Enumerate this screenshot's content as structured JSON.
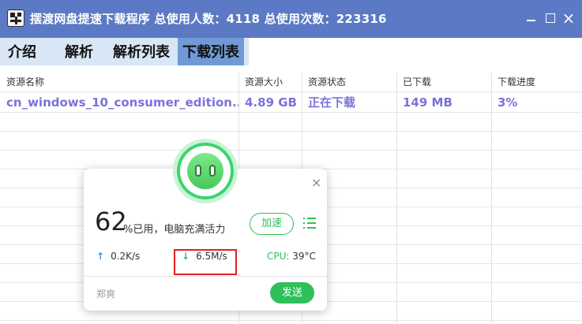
{
  "window": {
    "title": "摆渡网盘提速下载程序 总使用人数：4118 总使用次数：223316",
    "icon": "app-icon",
    "controls": {
      "minimize": "minimize-icon",
      "maximize": "maximize-icon",
      "close": "×"
    }
  },
  "tabs": [
    {
      "label": "介绍"
    },
    {
      "label": "解析"
    },
    {
      "label": "解析列表"
    },
    {
      "label": "下载列表",
      "active": true
    }
  ],
  "table": {
    "columns": [
      "资源名称",
      "资源大小",
      "资源状态",
      "已下载",
      "下载进度"
    ],
    "rows": [
      {
        "name": "cn_windows_10_consumer_edition...",
        "size": "4.89 GB",
        "status": "正在下载",
        "downloaded": "149 MB",
        "progress": "3%"
      }
    ]
  },
  "popup": {
    "close": "×",
    "percent": "62",
    "percent_text": "%已用，电脑充满活力",
    "boost_label": "加速",
    "upload_speed": "0.2K/s",
    "download_speed": "6.5M/s",
    "cpu_label": "CPU:",
    "cpu_value": "39°C",
    "author": "郑爽",
    "send_label": "发送"
  },
  "colors": {
    "titlebar": "#5b79c5",
    "active_tab": "#6f9ad6",
    "row_text": "#7b73d9",
    "accent_green": "#2fbf5b",
    "upload_blue": "#3b8fe6",
    "highlight_red": "#e02020"
  }
}
